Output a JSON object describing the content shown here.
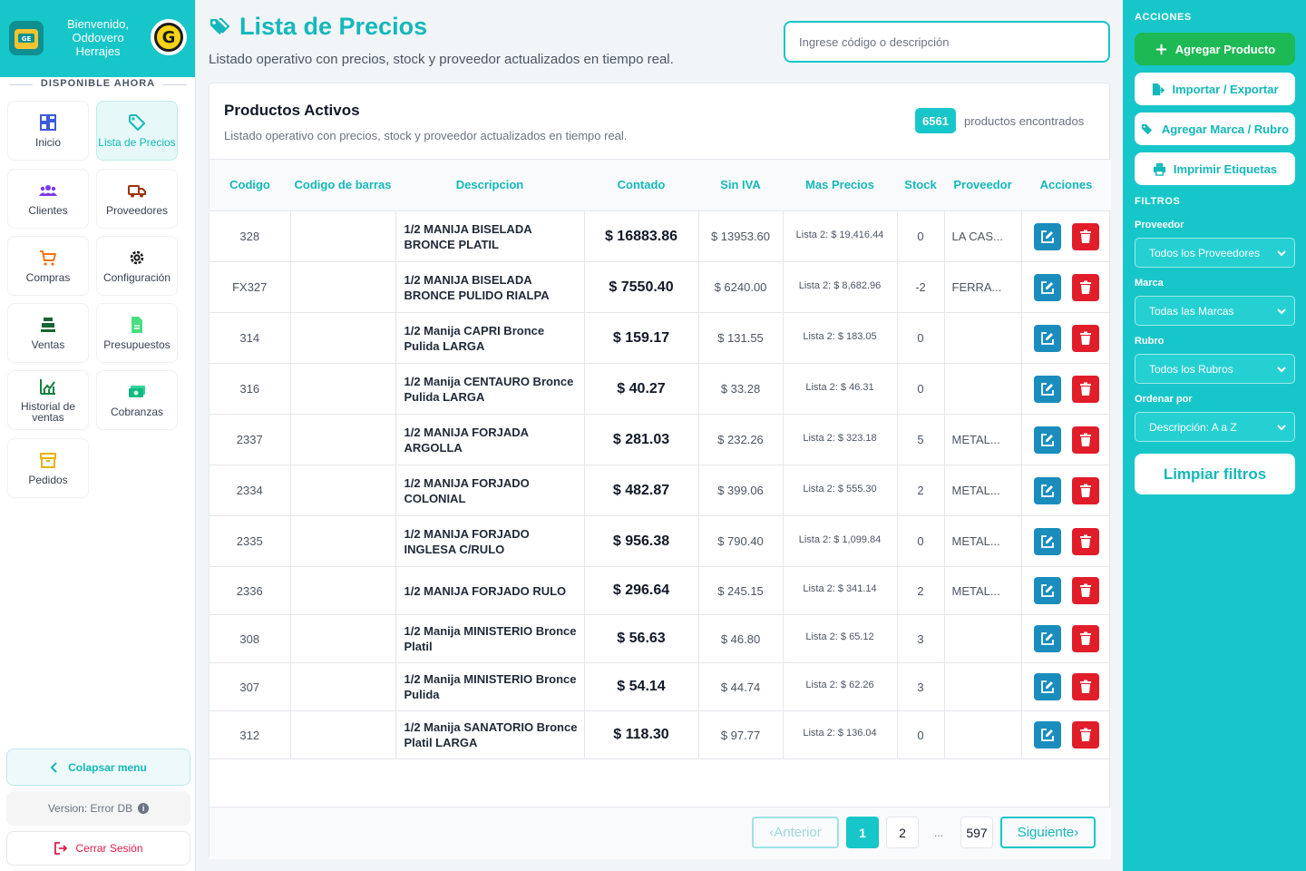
{
  "sidebar": {
    "welcome": "Bienvenido, Oddovero Herrajes",
    "section_label": "DISPONIBLE AHORA",
    "items": [
      {
        "label": "Inicio"
      },
      {
        "label": "Lista de Precios"
      },
      {
        "label": "Clientes"
      },
      {
        "label": "Proveedores"
      },
      {
        "label": "Compras"
      },
      {
        "label": "Configuración"
      },
      {
        "label": "Ventas"
      },
      {
        "label": "Presupuestos"
      },
      {
        "label": "Historial de ventas"
      },
      {
        "label": "Cobranzas"
      },
      {
        "label": "Pedidos"
      }
    ],
    "collapse_label": "Colapsar menu",
    "version_label": "Version: Error DB",
    "logout_label": "Cerrar Sesión"
  },
  "header": {
    "title": "Lista de Precios",
    "subtitle": "Listado operativo con precios, stock y proveedor actualizados en tiempo real.",
    "search_placeholder": "Ingrese código o descripción"
  },
  "card": {
    "title": "Productos Activos",
    "subtitle": "Listado operativo con precios, stock y proveedor actualizados en tiempo real.",
    "count": "6561",
    "count_label": "productos encontrados"
  },
  "table": {
    "columns": [
      "Codigo",
      "Codigo de barras",
      "Descripcion",
      "Contado",
      "Sin IVA",
      "Mas Precios",
      "Stock",
      "Proveedor",
      "Acciones"
    ],
    "rows": [
      {
        "codigo": "328",
        "barras": "",
        "descripcion": "1/2 MANIJA BISELADA BRONCE PLATIL",
        "contado": "$ 16883.86",
        "sin_iva": "$ 13953.60",
        "mas_precios": "Lista 2: $ 19,416.44",
        "stock": "0",
        "proveedor": "LA CAS..."
      },
      {
        "codigo": "FX327",
        "barras": "",
        "descripcion": "1/2 MANIJA BISELADA BRONCE PULIDO RIALPA",
        "contado": "$ 7550.40",
        "sin_iva": "$ 6240.00",
        "mas_precios": "Lista 2: $ 8,682.96",
        "stock": "-2",
        "proveedor": "FERRA..."
      },
      {
        "codigo": "314",
        "barras": "",
        "descripcion": "1/2 Manija CAPRI Bronce Pulida LARGA",
        "contado": "$ 159.17",
        "sin_iva": "$ 131.55",
        "mas_precios": "Lista 2: $ 183.05",
        "stock": "0",
        "proveedor": ""
      },
      {
        "codigo": "316",
        "barras": "",
        "descripcion": "1/2 Manija CENTAURO Bronce Pulida LARGA",
        "contado": "$ 40.27",
        "sin_iva": "$ 33.28",
        "mas_precios": "Lista 2: $ 46.31",
        "stock": "0",
        "proveedor": ""
      },
      {
        "codigo": "2337",
        "barras": "",
        "descripcion": "1/2 MANIJA FORJADA ARGOLLA",
        "contado": "$ 281.03",
        "sin_iva": "$ 232.26",
        "mas_precios": "Lista 2: $ 323.18",
        "stock": "5",
        "proveedor": "METAL..."
      },
      {
        "codigo": "2334",
        "barras": "",
        "descripcion": "1/2 MANIJA FORJADO COLONIAL",
        "contado": "$ 482.87",
        "sin_iva": "$ 399.06",
        "mas_precios": "Lista 2: $ 555.30",
        "stock": "2",
        "proveedor": "METAL..."
      },
      {
        "codigo": "2335",
        "barras": "",
        "descripcion": "1/2 MANIJA FORJADO INGLESA C/RULO",
        "contado": "$ 956.38",
        "sin_iva": "$ 790.40",
        "mas_precios": "Lista 2: $ 1,099.84",
        "stock": "0",
        "proveedor": "METAL..."
      },
      {
        "codigo": "2336",
        "barras": "",
        "descripcion": "1/2 MANIJA FORJADO RULO",
        "contado": "$ 296.64",
        "sin_iva": "$ 245.15",
        "mas_precios": "Lista 2: $ 341.14",
        "stock": "2",
        "proveedor": "METAL..."
      },
      {
        "codigo": "308",
        "barras": "",
        "descripcion": "1/2 Manija MINISTERIO Bronce Platil",
        "contado": "$ 56.63",
        "sin_iva": "$ 46.80",
        "mas_precios": "Lista 2: $ 65.12",
        "stock": "3",
        "proveedor": ""
      },
      {
        "codigo": "307",
        "barras": "",
        "descripcion": "1/2 Manija MINISTERIO Bronce Pulida",
        "contado": "$ 54.14",
        "sin_iva": "$ 44.74",
        "mas_precios": "Lista 2: $ 62.26",
        "stock": "3",
        "proveedor": ""
      },
      {
        "codigo": "312",
        "barras": "",
        "descripcion": "1/2 Manija SANATORIO Bronce Platil LARGA",
        "contado": "$ 118.30",
        "sin_iva": "$ 97.77",
        "mas_precios": "Lista 2: $ 136.04",
        "stock": "0",
        "proveedor": ""
      }
    ]
  },
  "pagination": {
    "prev_label": "Anterior",
    "next_label": "Siguiente",
    "pages": [
      "1",
      "2",
      "...",
      "597"
    ],
    "current": "1"
  },
  "right_panel": {
    "actions_heading": "ACCIONES",
    "add_product": "Agregar Producto",
    "import_export": "Importar / Exportar",
    "add_brand": "Agregar Marca / Rubro",
    "print_labels": "Imprimir Etiquetas",
    "filters_heading": "FILTROS",
    "provider_label": "Proveedor",
    "provider_value": "Todos los Proveedores",
    "brand_label": "Marca",
    "brand_value": "Todas las Marcas",
    "category_label": "Rubro",
    "category_value": "Todos los Rubros",
    "order_label": "Ordenar por",
    "order_value": "Descripción: A a Z",
    "clear_filters": "Limpiar filtros"
  },
  "colors": {
    "accent": "#17c6c9",
    "edit": "#1a8dbd",
    "delete": "#e11d2a",
    "add_green": "#1db954"
  },
  "icons": {
    "nav": [
      "grid-icon",
      "tag-icon",
      "users-icon",
      "truck-icon",
      "cart-icon",
      "gear-icon",
      "cash-register-icon",
      "document-icon",
      "chart-icon",
      "money-icon",
      "box-icon"
    ],
    "title": "tags-icon",
    "actions": [
      "edit-icon",
      "trash-icon"
    ]
  }
}
